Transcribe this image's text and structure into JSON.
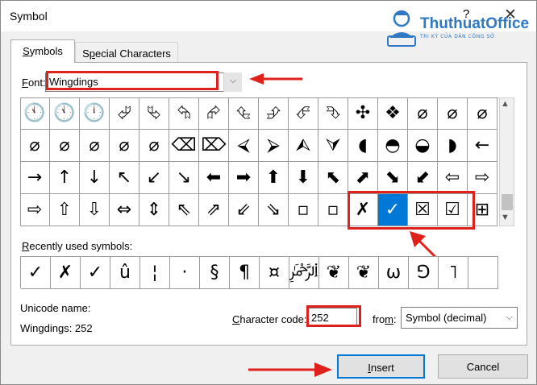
{
  "window": {
    "title": "Symbol",
    "help_glyph": "?",
    "close_glyph": "✕"
  },
  "logo": {
    "name": "ThuthuatOffice",
    "tagline": "TRI KỲ CỦA DÂN CÔNG SỞ",
    "icon": "person-with-laptop-icon",
    "color": "#2f78c4"
  },
  "tabs": [
    {
      "label_pre": "",
      "label_ul": "S",
      "label_post": "ymbols"
    },
    {
      "label_pre": "S",
      "label_ul": "p",
      "label_post": "ecial Characters"
    }
  ],
  "font": {
    "label_ul": "F",
    "label_post": "ont:",
    "value": "Wingdings",
    "dropdown_glyph": "⌵"
  },
  "symbol_grid": {
    "rows": [
      [
        "🕚",
        "🕚",
        "🕛",
        "⮰",
        "⮱",
        "⮲",
        "⮳",
        "⮴",
        "⮵",
        "⮶",
        "⮷",
        "✣",
        "❖",
        "⌀",
        "⌀",
        "⌀"
      ],
      [
        "⌀",
        "⌀",
        "⌀",
        "⌀",
        "⌀",
        "⌫",
        "⌦",
        "⮘",
        "⮚",
        "⮙",
        "⮛",
        "◖",
        "◓",
        "◒",
        "◗",
        "←"
      ],
      [
        "→",
        "↑",
        "↓",
        "↖",
        "↙",
        "↘",
        "⬅",
        "➡",
        "⬆",
        "⬇",
        "⬉",
        "⬈",
        "⬊",
        "⬋",
        "⇦",
        "⇨"
      ],
      [
        "⇨",
        "⇧",
        "⇩",
        "⇔",
        "⇕",
        "⇖",
        "⇗",
        "⇙",
        "⇘",
        "▫",
        "▫",
        "✗",
        "✓",
        "☒",
        "☑",
        "⊞"
      ]
    ],
    "selected_row": 3,
    "selected_col": 12,
    "scroll_up": "▲",
    "scroll_down": "▼",
    "selection_color": "#0078d7"
  },
  "recent": {
    "label_ul": "R",
    "label_post": "ecently used symbols:",
    "symbols": [
      "✓",
      "✗",
      "✓",
      "û",
      "¦",
      "·",
      "§",
      "¶",
      "¤",
      "﷽",
      "❦",
      "❦",
      "ω",
      "⅁",
      "˥",
      "",
      "",
      ""
    ]
  },
  "unicode": {
    "label": "Unicode name:",
    "value": "Wingdings: 252"
  },
  "character_code": {
    "label_ul": "C",
    "label_post": "haracter code:",
    "value": "252"
  },
  "from": {
    "label_pre": "fro",
    "label_ul": "m",
    "label_post": ":",
    "value": "Symbol (decimal)",
    "dropdown_glyph": "⌵"
  },
  "buttons": {
    "insert_ul": "I",
    "insert_post": "nsert",
    "cancel": "Cancel"
  },
  "annotation_color": "#e0201b"
}
